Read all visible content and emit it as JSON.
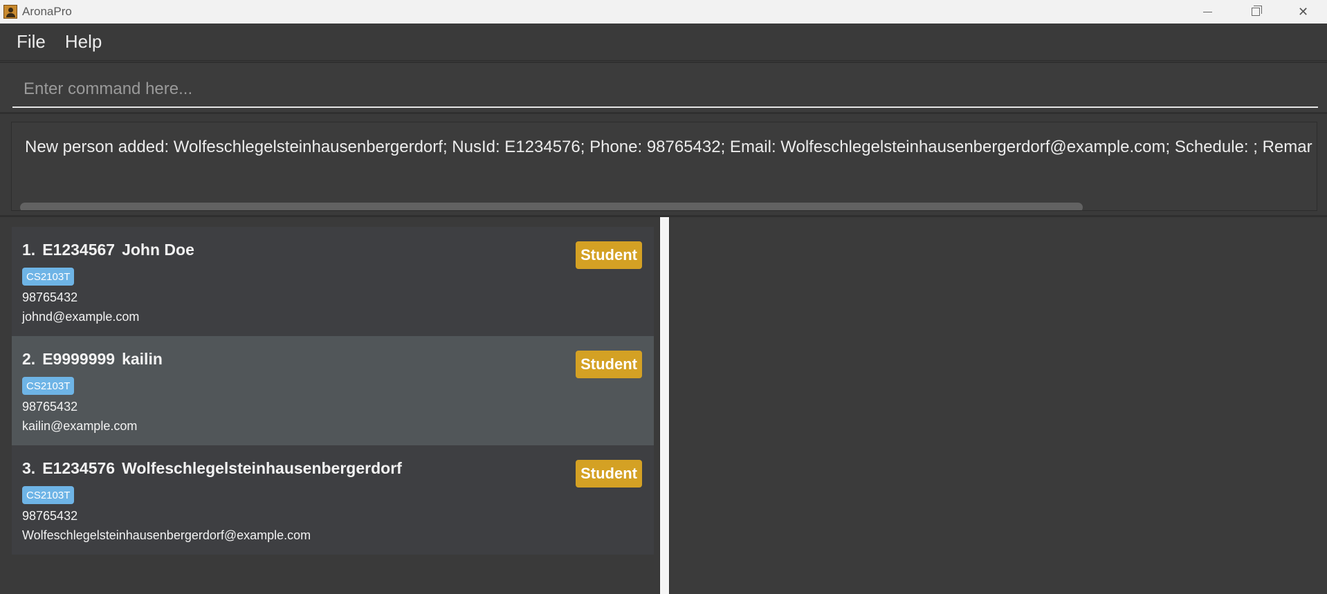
{
  "window": {
    "title": "AronaPro",
    "minimize_glyph": "",
    "restore_glyph": "",
    "close_glyph": "✕"
  },
  "menu": {
    "file": "File",
    "help": "Help"
  },
  "command": {
    "placeholder": "Enter command here...",
    "value": ""
  },
  "result": {
    "message": "New person added: Wolfeschlegelsteinhausenbergerdorf; NusId: E1234576; Phone: 98765432; Email: Wolfeschlegelsteinhausenbergerdorf@example.com; Schedule: ; Remar"
  },
  "persons": [
    {
      "index": "1.",
      "nusid": "E1234567",
      "name": "John Doe",
      "tag": "CS2103T",
      "phone": "98765432",
      "email": "johnd@example.com",
      "role": "Student",
      "selected": false
    },
    {
      "index": "2.",
      "nusid": "E9999999",
      "name": "kailin",
      "tag": "CS2103T",
      "phone": "98765432",
      "email": "kailin@example.com",
      "role": "Student",
      "selected": true
    },
    {
      "index": "3.",
      "nusid": "E1234576",
      "name": "Wolfeschlegelsteinhausenbergerdorf",
      "tag": "CS2103T",
      "phone": "98765432",
      "email": "Wolfeschlegelsteinhausenbergerdorf@example.com",
      "role": "Student",
      "selected": false
    }
  ],
  "colors": {
    "tag": "#6eb4e6",
    "role_badge": "#d4a124",
    "selected_card": "#515659"
  },
  "icons": {
    "app": "app-logo-icon",
    "minimize": "minimize-icon",
    "restore": "restore-icon",
    "close": "close-icon"
  }
}
